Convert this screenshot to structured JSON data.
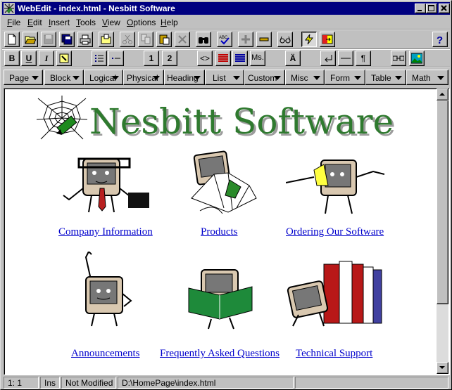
{
  "window": {
    "title": "WebEdit - index.html - Nesbitt Software"
  },
  "menu": [
    {
      "label": "File",
      "underline": "F",
      "rest": "ile"
    },
    {
      "label": "Edit",
      "underline": "E",
      "rest": "dit"
    },
    {
      "label": "Insert",
      "underline": "I",
      "rest": "nsert"
    },
    {
      "label": "Tools",
      "underline": "T",
      "rest": "ools"
    },
    {
      "label": "View",
      "underline": "V",
      "rest": "iew"
    },
    {
      "label": "Options",
      "underline": "O",
      "rest": "ptions"
    },
    {
      "label": "Help",
      "underline": "H",
      "rest": "elp"
    }
  ],
  "format_toolbar": {
    "bold": "B",
    "underline": "U",
    "italic": "I",
    "heading1": "1",
    "heading2": "2",
    "tag": "<>",
    "ms": "Ms.",
    "special_char": "Ä",
    "paragraph": "¶"
  },
  "dropdowns": [
    "Page",
    "Block",
    "Logical",
    "Physical",
    "Heading",
    "List",
    "Custom",
    "Misc",
    "Form",
    "Table",
    "Math"
  ],
  "document": {
    "logo_text": "Nesbitt Software",
    "links": [
      "Company Information",
      "Products",
      "Ordering Our Software",
      "Announcements",
      "Frequently Asked Questions",
      "Technical Support"
    ]
  },
  "status": {
    "position": "1: 1",
    "mode": "Ins",
    "modified": "Not Modified",
    "path": "D:\\HomePage\\index.html"
  },
  "colors": {
    "titlebar": "#000080",
    "logo_green": "#2f7a2f",
    "link_blue": "#0000cc"
  }
}
